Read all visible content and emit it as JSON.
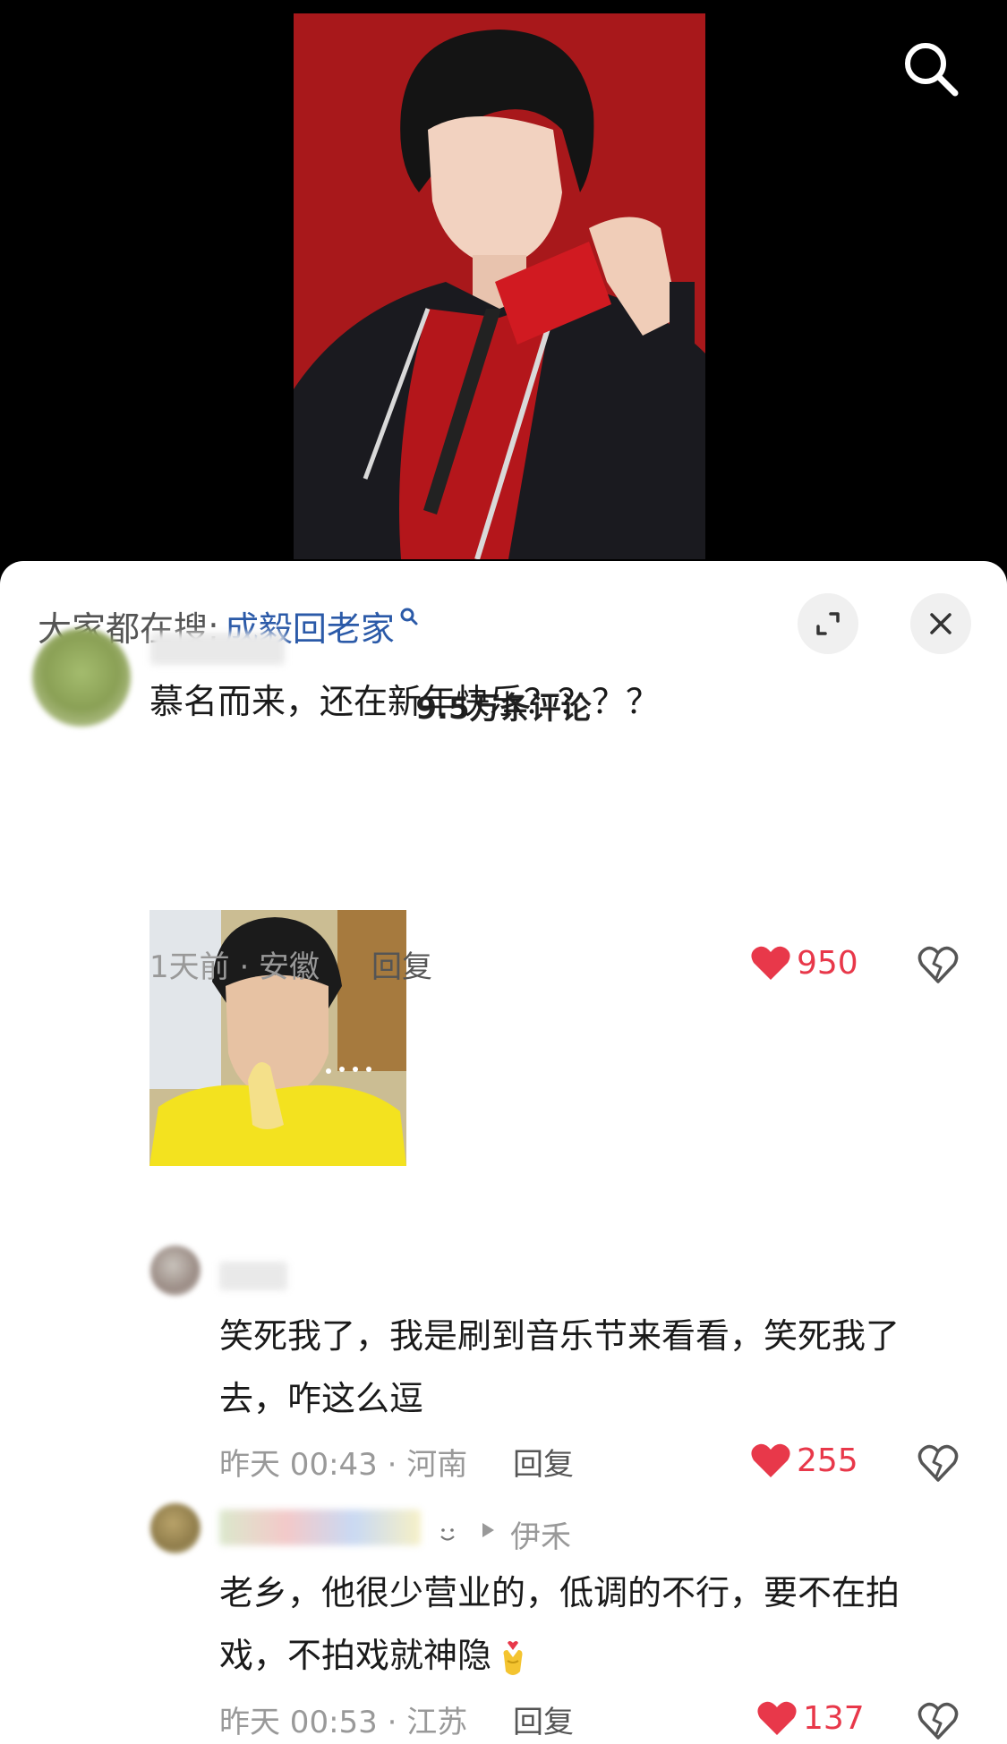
{
  "header": {
    "search_icon": "search-icon"
  },
  "hot_search": {
    "label": "大家都在搜:",
    "keyword": "成毅回老家"
  },
  "comment_count": "9.5万条评论",
  "comments": [
    {
      "text": "慕名而来，还在新年快乐？？？？",
      "time_location": "1天前 · 安徽",
      "reply_label": "回复",
      "likes": "950"
    },
    {
      "text": "笑死我了，我是刷到音乐节来看看，笑死我了去，咋这么逗",
      "time_location": "昨天 00:43 · 河南",
      "reply_label": "回复",
      "likes": "255"
    },
    {
      "reply_to": "伊禾",
      "text": "老乡，他很少营业的，低调的不行，要不在拍戏，不拍戏就神隐",
      "time_location": "昨天 00:53 · 江苏",
      "reply_label": "回复",
      "likes": "137"
    }
  ],
  "colors": {
    "accent": "#2b5aa8",
    "like": "#e8384a"
  }
}
